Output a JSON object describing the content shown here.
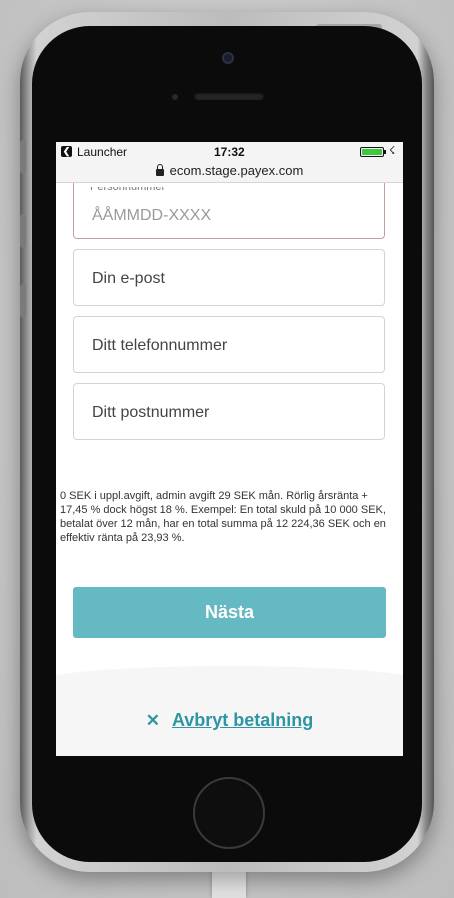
{
  "status_bar": {
    "back_app": "Launcher",
    "time": "17:32",
    "url": "ecom.stage.payex.com",
    "battery_level": 1.0
  },
  "form": {
    "personal_number": {
      "label": "Personnummer",
      "placeholder": "ÅÅMMDD-XXXX"
    },
    "email": {
      "placeholder": "Din e-post"
    },
    "phone": {
      "placeholder": "Ditt telefonnummer"
    },
    "postal_code": {
      "placeholder": "Ditt postnummer"
    }
  },
  "disclaimer": "0 SEK i uppl.avgift, admin avgift 29 SEK mån. Rörlig årsränta + 17,45 % dock högst 18 %. Exempel: En total skuld på 10 000 SEK, betalat över 12 mån, har en total summa på 12 224,36 SEK och en effektiv ränta på 23,93 %.",
  "next_button": "Nästa",
  "cancel": {
    "icon": "close-icon",
    "label": "Avbryt betalning"
  },
  "colors": {
    "accent": "#65b9c2",
    "link": "#2e95a3",
    "battery": "#3ec83e"
  }
}
